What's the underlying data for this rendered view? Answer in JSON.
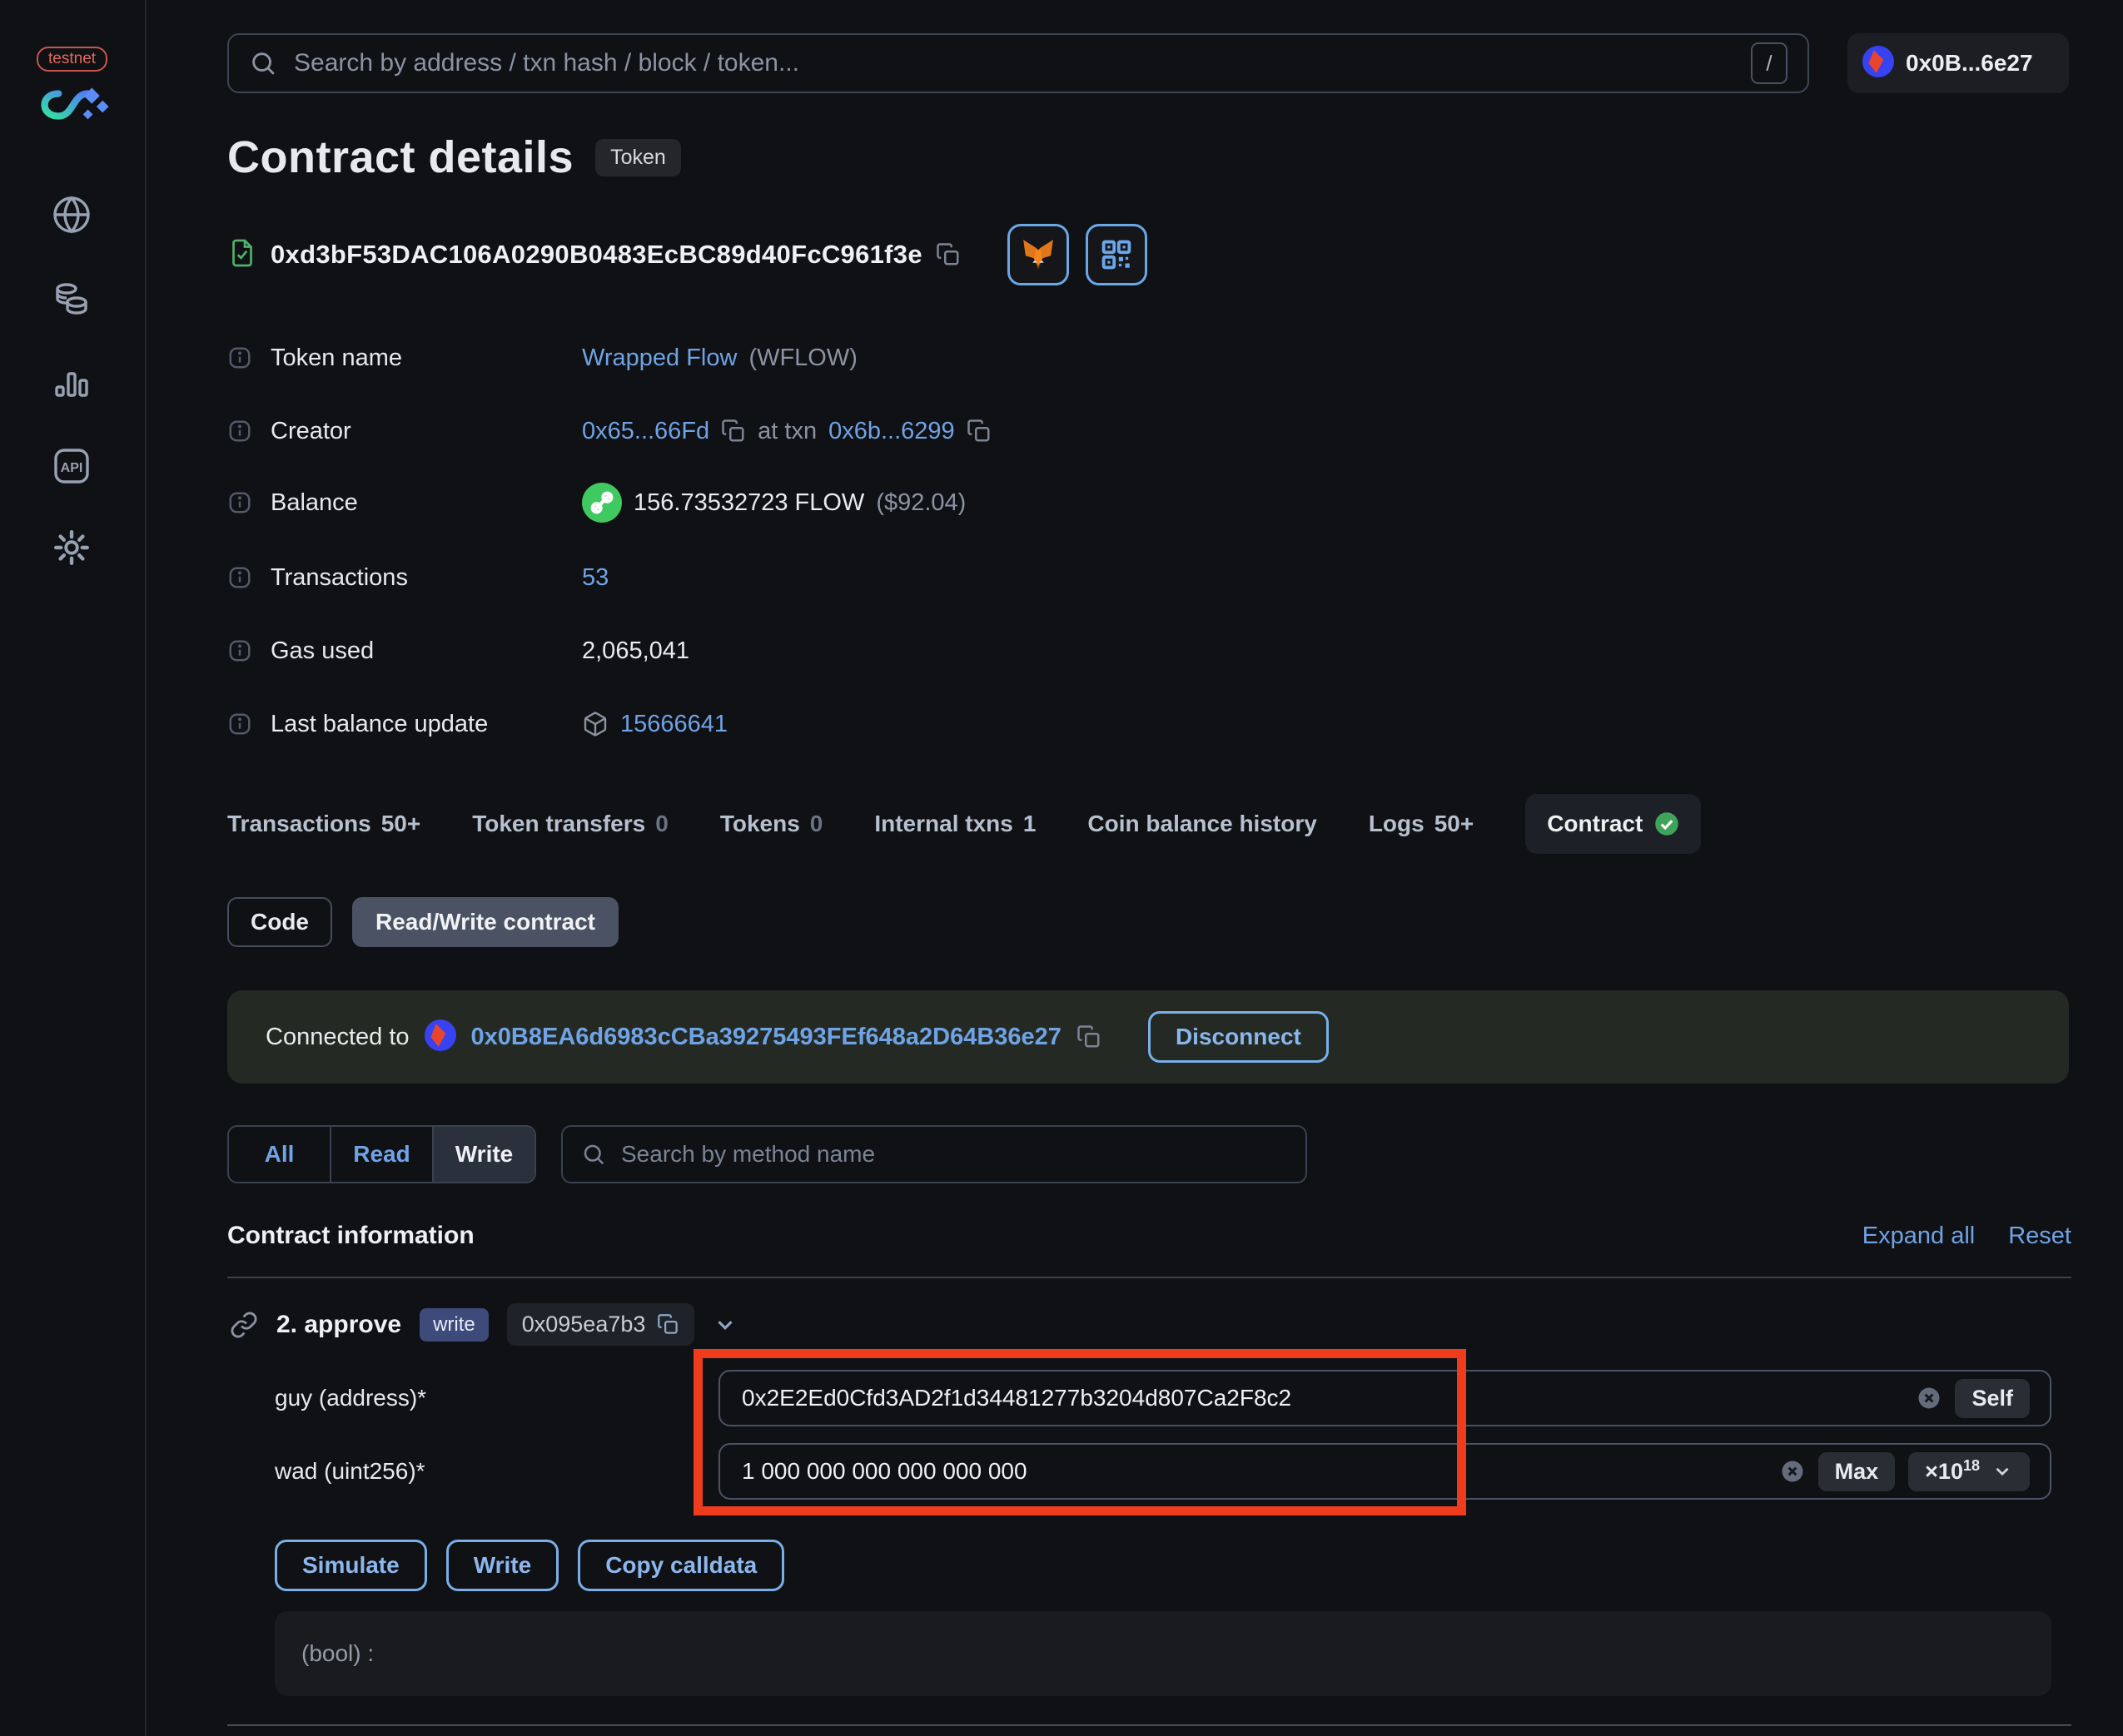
{
  "sidebar": {
    "env_badge": "testnet",
    "api_icon_text": "API"
  },
  "topbar": {
    "search_placeholder": "Search by address / txn hash / block / token...",
    "shortcut_hint": "/",
    "account_label": "0x0B...6e27"
  },
  "page": {
    "title": "Contract details",
    "badge": "Token",
    "address": "0xd3bF53DAC106A0290B0483EcBC89d40FcC961f3e"
  },
  "details": {
    "token_name": {
      "label": "Token name",
      "link": "Wrapped Flow",
      "symbol": "(WFLOW)"
    },
    "creator": {
      "label": "Creator",
      "address": "0x65...66Fd",
      "at_txn": "at txn",
      "txn": "0x6b...6299"
    },
    "balance": {
      "label": "Balance",
      "amount": "156.73532723 FLOW",
      "usd": "($92.04)"
    },
    "transactions": {
      "label": "Transactions",
      "value": "53"
    },
    "gas_used": {
      "label": "Gas used",
      "value": "2,065,041"
    },
    "last_balance_update": {
      "label": "Last balance update",
      "block": "15666641"
    }
  },
  "tabs": [
    {
      "label": "Transactions",
      "count": "50+"
    },
    {
      "label": "Token transfers",
      "count": "0"
    },
    {
      "label": "Tokens",
      "count": "0"
    },
    {
      "label": "Internal txns",
      "count": "1"
    },
    {
      "label": "Coin balance history",
      "count": ""
    },
    {
      "label": "Logs",
      "count": "50+"
    },
    {
      "label": "Contract",
      "count": ""
    }
  ],
  "subtabs": {
    "code": "Code",
    "read_write": "Read/Write contract"
  },
  "connection": {
    "prefix": "Connected to",
    "address": "0x0B8EA6d6983cCBa39275493FEf648a2D64B36e27",
    "disconnect": "Disconnect"
  },
  "method_filter": {
    "all": "All",
    "read": "Read",
    "write": "Write",
    "search_placeholder": "Search by method name"
  },
  "contract_info": {
    "title": "Contract information",
    "expand_all": "Expand all",
    "reset": "Reset"
  },
  "method": {
    "name": "2. approve",
    "badge": "write",
    "selector": "0x095ea7b3"
  },
  "fields": [
    {
      "label": "guy (address)*",
      "value": "0x2E2Ed0Cfd3AD2f1d34481277b3204d807Ca2F8c2"
    },
    {
      "label": "wad (uint256)*",
      "value": "1 000 000 000 000 000 000"
    }
  ],
  "field_actions": {
    "self": "Self",
    "max": "Max",
    "multiplier": "×10",
    "exponent": "18"
  },
  "actions": {
    "simulate": "Simulate",
    "write": "Write",
    "copy_calldata": "Copy calldata"
  },
  "output": {
    "result": "(bool) :"
  },
  "colors": {
    "accent_blue": "#6fa3e6",
    "flow_green": "#41c961",
    "verified_green": "#4db26b",
    "annotation_red": "#ee3c1d",
    "banner_green": "#242a23"
  }
}
